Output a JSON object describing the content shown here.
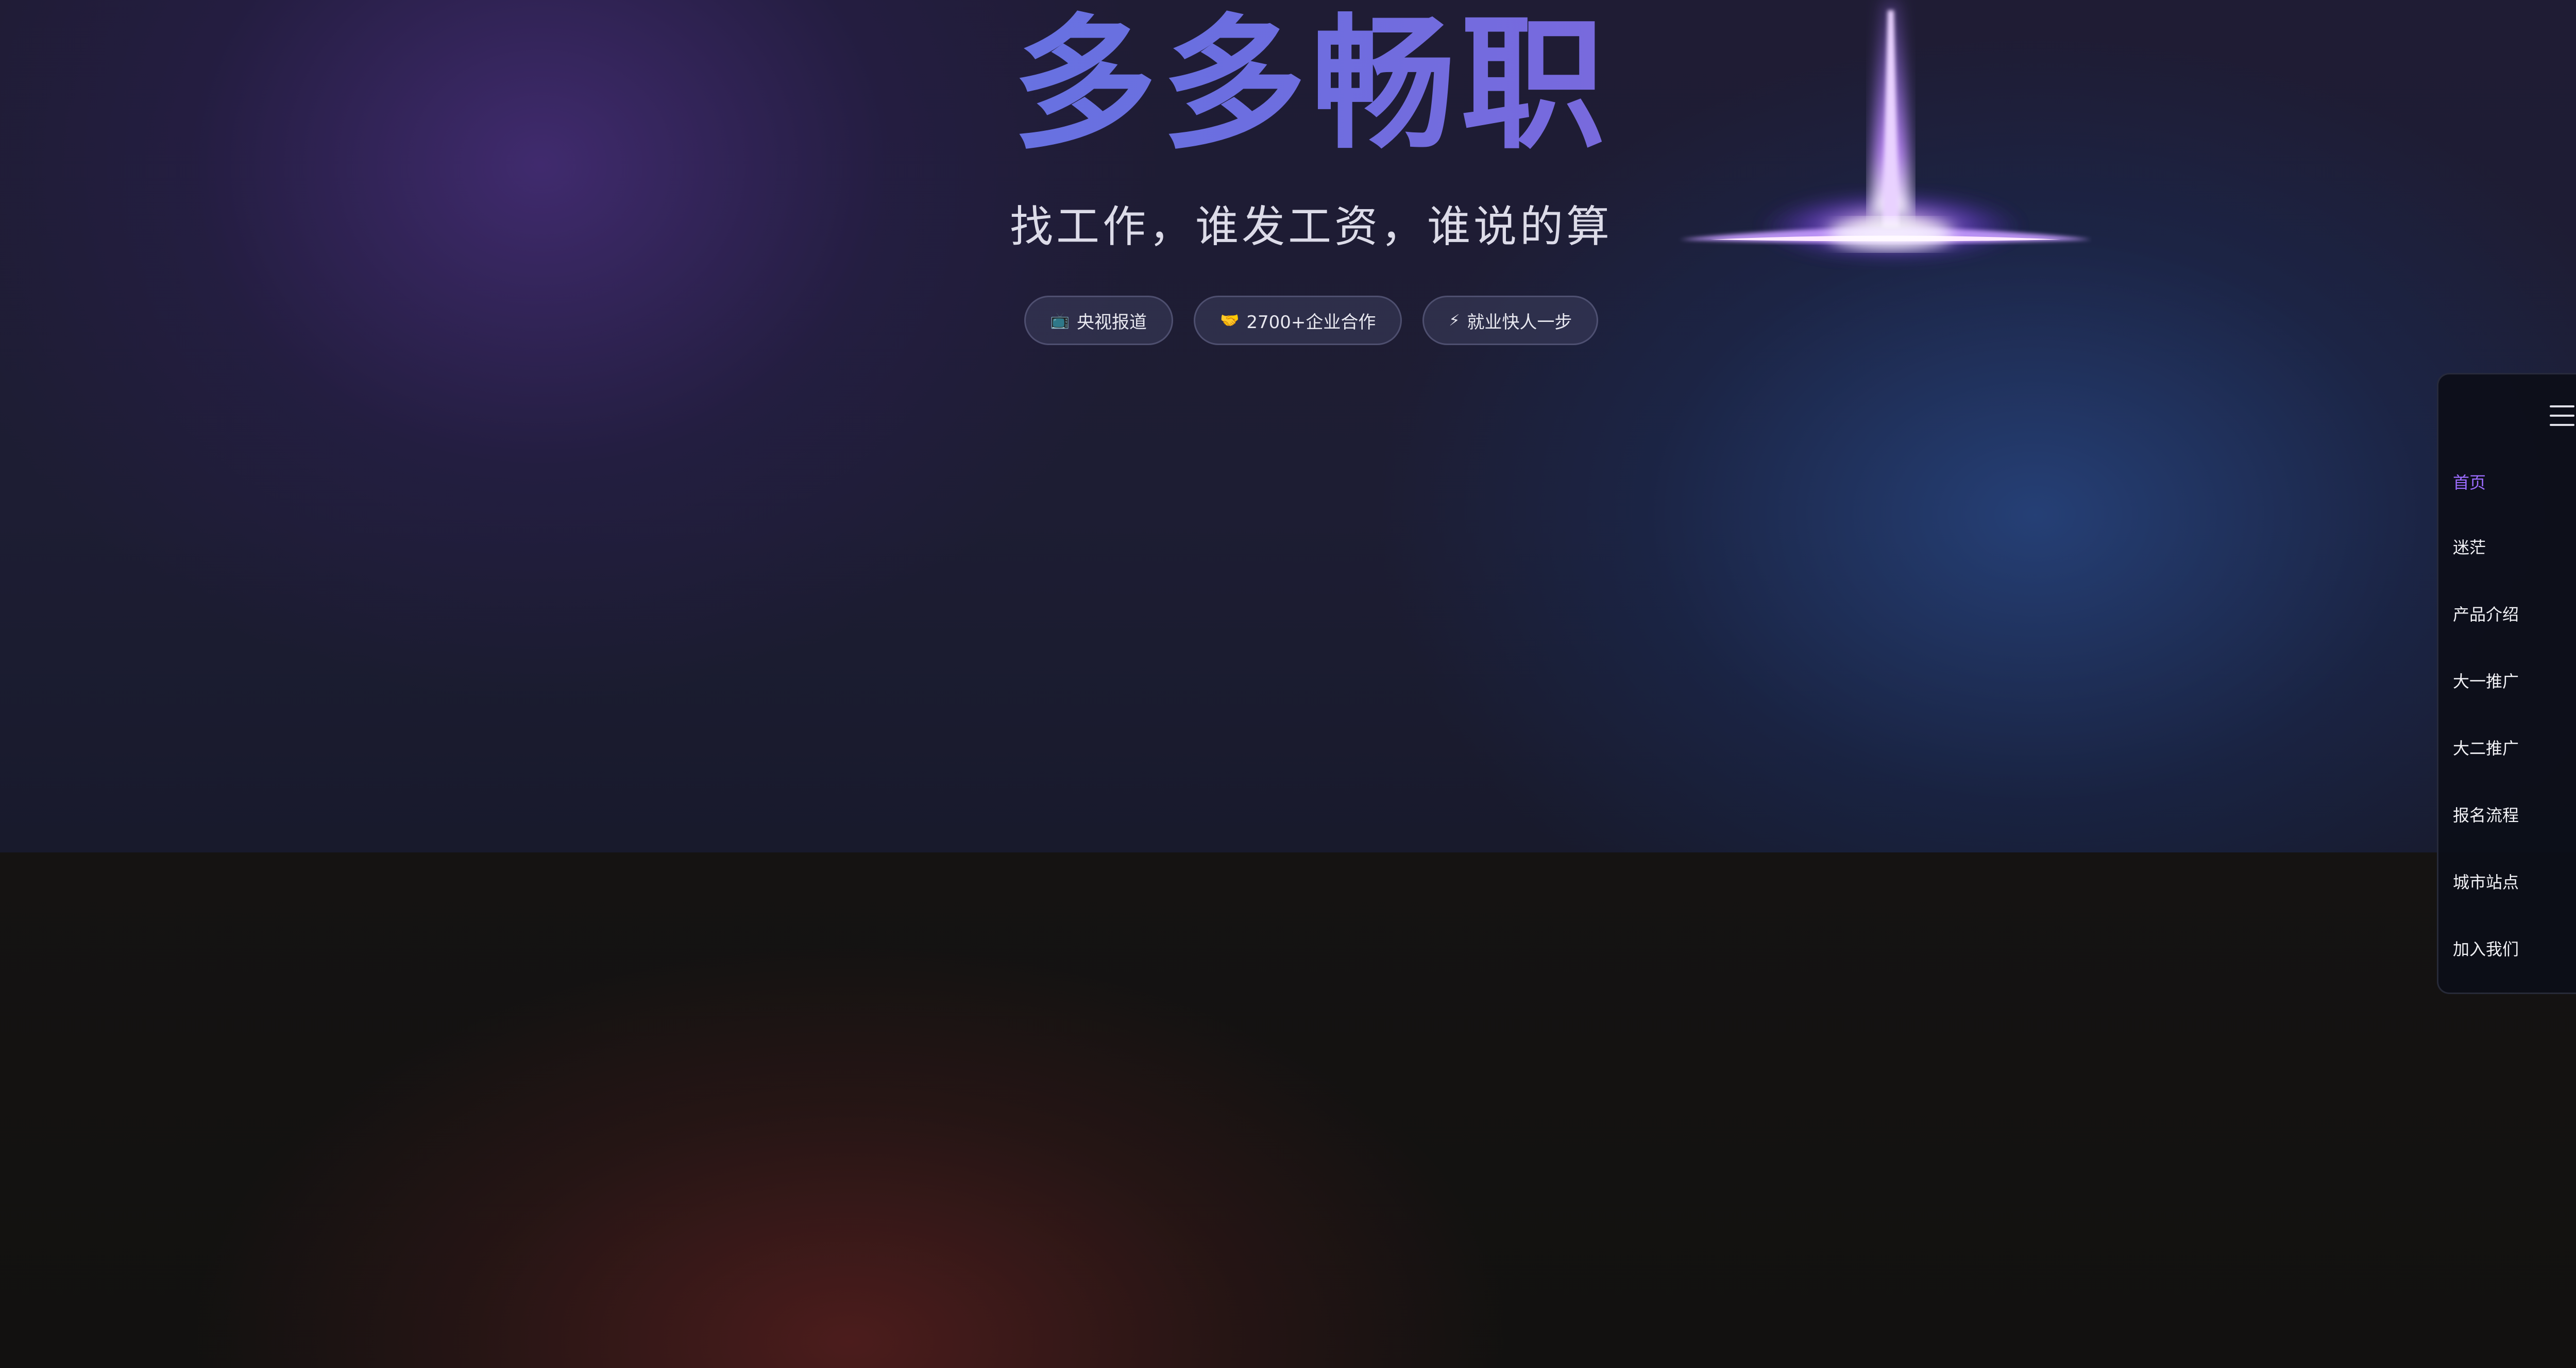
{
  "hero": {
    "title": "多多畅职",
    "subtitle": "找工作，谁发工资，谁说的算",
    "badges": [
      {
        "icon": "📺",
        "icon_name": "tv-icon",
        "label": "央视报道"
      },
      {
        "icon": "🤝",
        "icon_name": "handshake-icon",
        "label": "2700+企业合作"
      },
      {
        "icon": "⚡",
        "icon_name": "lightning-icon",
        "label": "就业快人一步"
      }
    ]
  },
  "sidenav": {
    "menu_icon": "hamburger-menu-icon",
    "items": [
      {
        "label": "首页",
        "active": true
      },
      {
        "label": "迷茫",
        "active": false
      },
      {
        "label": "产品介绍",
        "active": false
      },
      {
        "label": "大一推广",
        "active": false
      },
      {
        "label": "大二推广",
        "active": false
      },
      {
        "label": "报名流程",
        "active": false
      },
      {
        "label": "城市站点",
        "active": false
      },
      {
        "label": "加入我们",
        "active": false
      }
    ]
  },
  "colors": {
    "accent": "#9c6cff",
    "title_gradient_start": "#5b82e8",
    "title_gradient_end": "#9a5cd6"
  }
}
